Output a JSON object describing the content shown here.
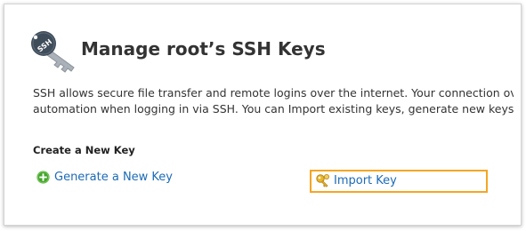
{
  "header": {
    "title": "Manage root’s SSH Keys",
    "icon_label": "SSH",
    "icon": "ssh-key-icon"
  },
  "description": {
    "line1": "SSH allows secure file transfer and remote logins over the internet. Your connection over SSH is encrypted allowing the same ease of connection as Telnet, without the",
    "line2": "automation when logging in via SSH. You can Import existing keys, generate new keys, as well as manage/delete keys."
  },
  "create_section": {
    "heading": "Create a New Key",
    "generate_label": "Generate a New Key",
    "generate_icon": "plus-circle-icon",
    "import_label": "Import Key",
    "import_icon": "key-icon"
  },
  "colors": {
    "link": "#1c6bb5",
    "highlight_border": "#f5a623",
    "plus_icon": "#44a52c",
    "key_icon": "#e8b72c"
  }
}
